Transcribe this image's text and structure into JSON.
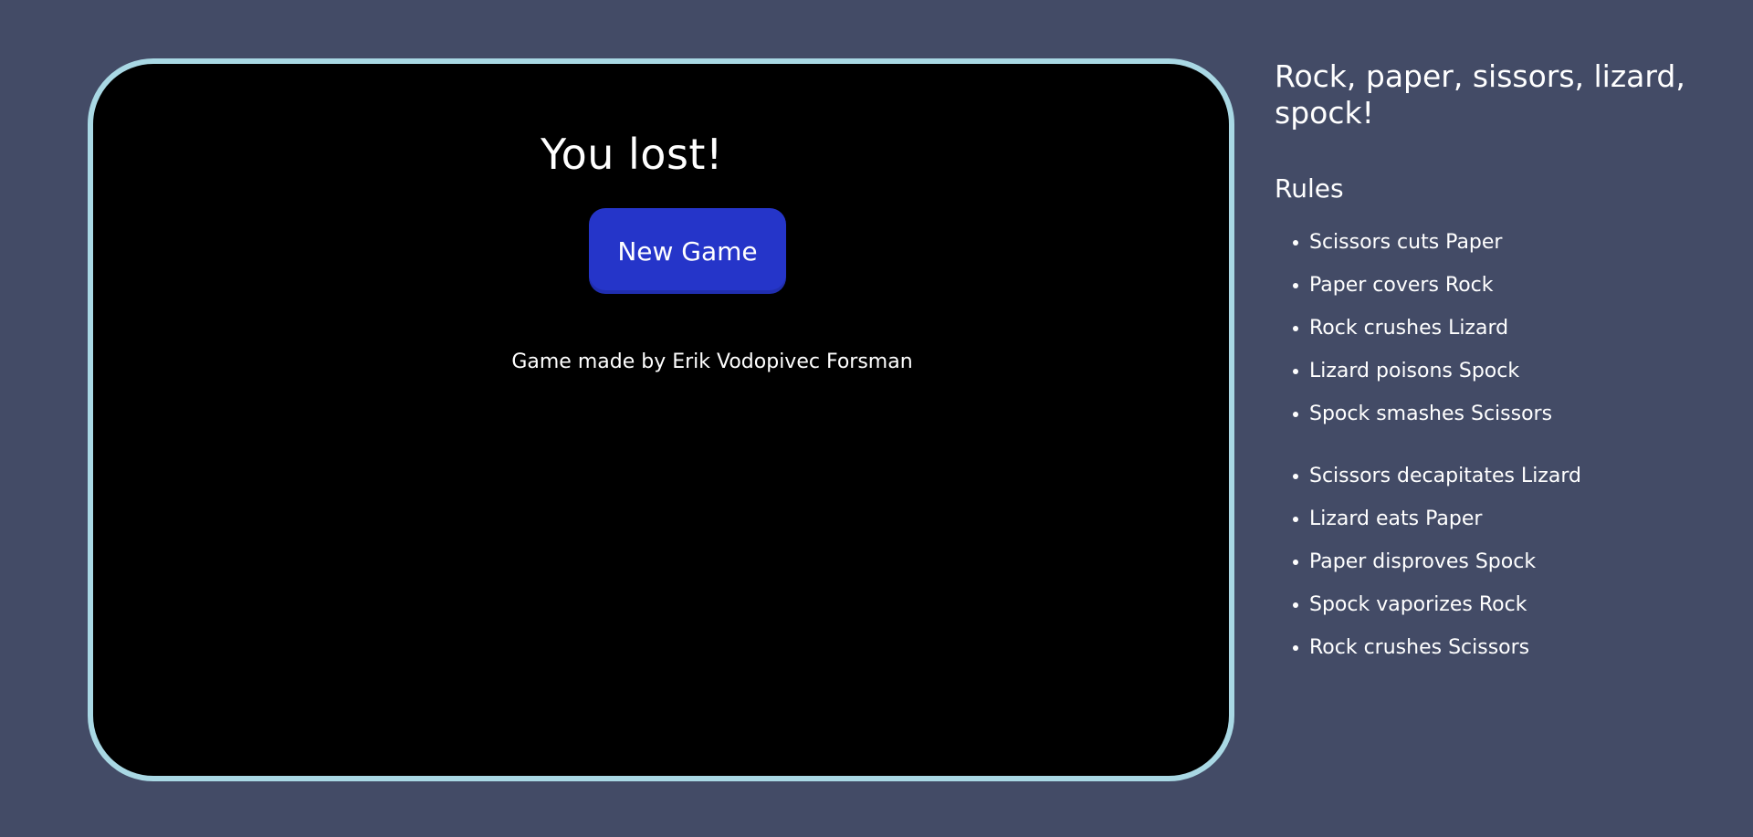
{
  "game": {
    "result_text": "You lost!",
    "new_game_label": "New Game",
    "credit": "Game made by Erik Vodopivec Forsman"
  },
  "sidebar": {
    "title": "Rock, paper, sissors, lizard, spock!",
    "rules_heading": "Rules",
    "rules": [
      "Scissors cuts Paper",
      "Paper covers Rock",
      "Rock crushes Lizard",
      "Lizard poisons Spock",
      "Spock smashes Scissors",
      "Scissors decapitates Lizard",
      "Lizard eats Paper",
      "Paper disproves Spock",
      "Spock vaporizes Rock",
      "Rock crushes Scissors"
    ]
  },
  "colors": {
    "page_background": "#434b66",
    "board_background": "#000000",
    "board_border": "#a9d8e4",
    "button_background": "#2535c9",
    "text": "#ffffff"
  }
}
